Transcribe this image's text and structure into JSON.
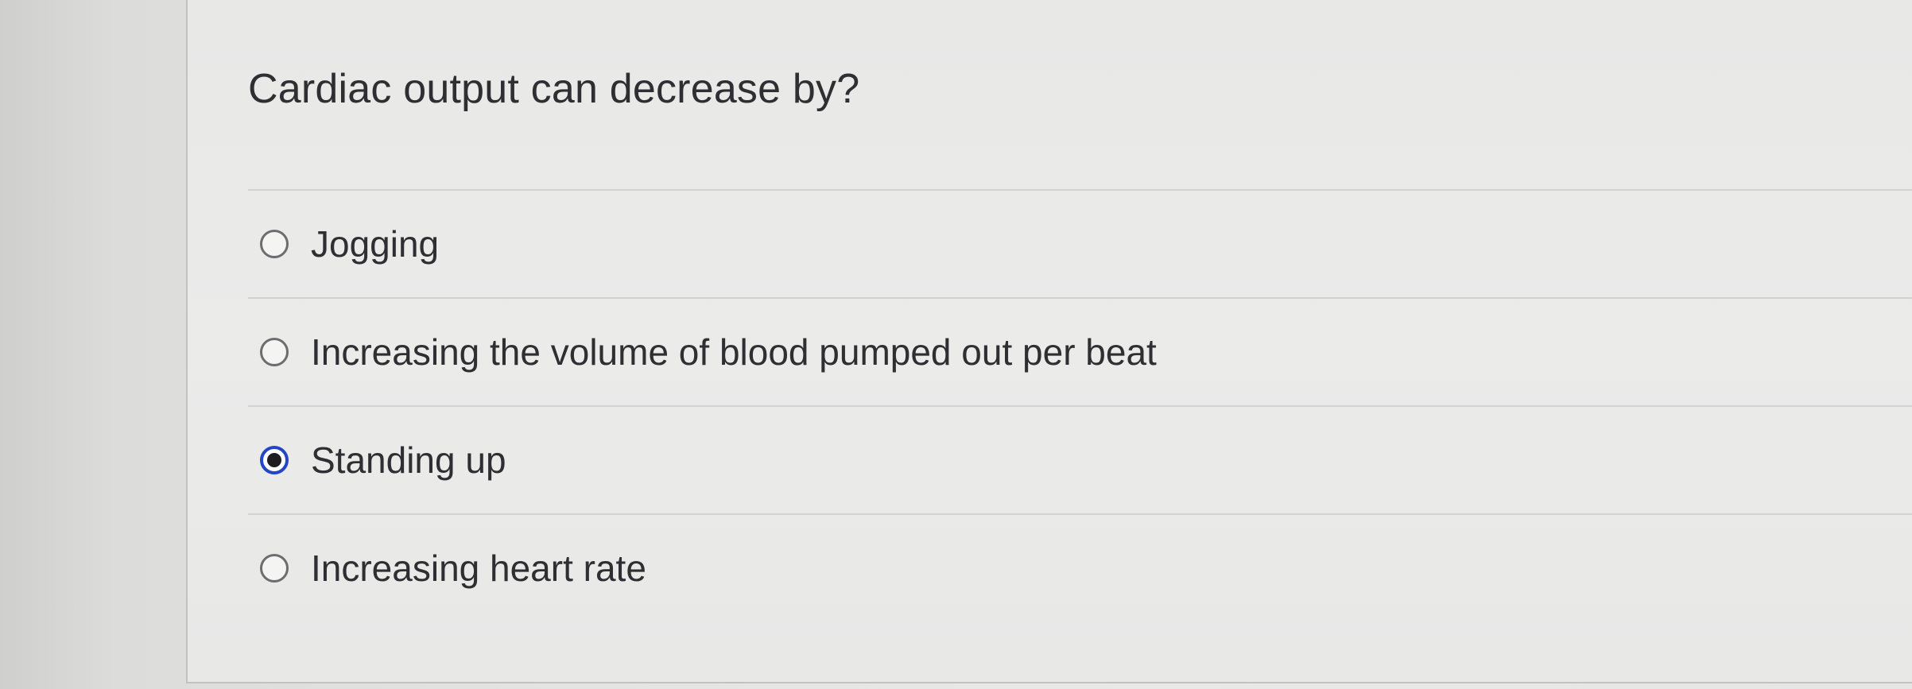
{
  "question": {
    "text": "Cardiac output can decrease by?"
  },
  "answers": [
    {
      "label": "Jogging",
      "selected": false
    },
    {
      "label": "Increasing the volume of blood pumped out per beat",
      "selected": false
    },
    {
      "label": "Standing up",
      "selected": true
    },
    {
      "label": "Increasing heart rate",
      "selected": false
    }
  ],
  "colors": {
    "selected_ring": "#2346c6",
    "text": "#2f2f33",
    "panel_background": "#ebebea"
  }
}
